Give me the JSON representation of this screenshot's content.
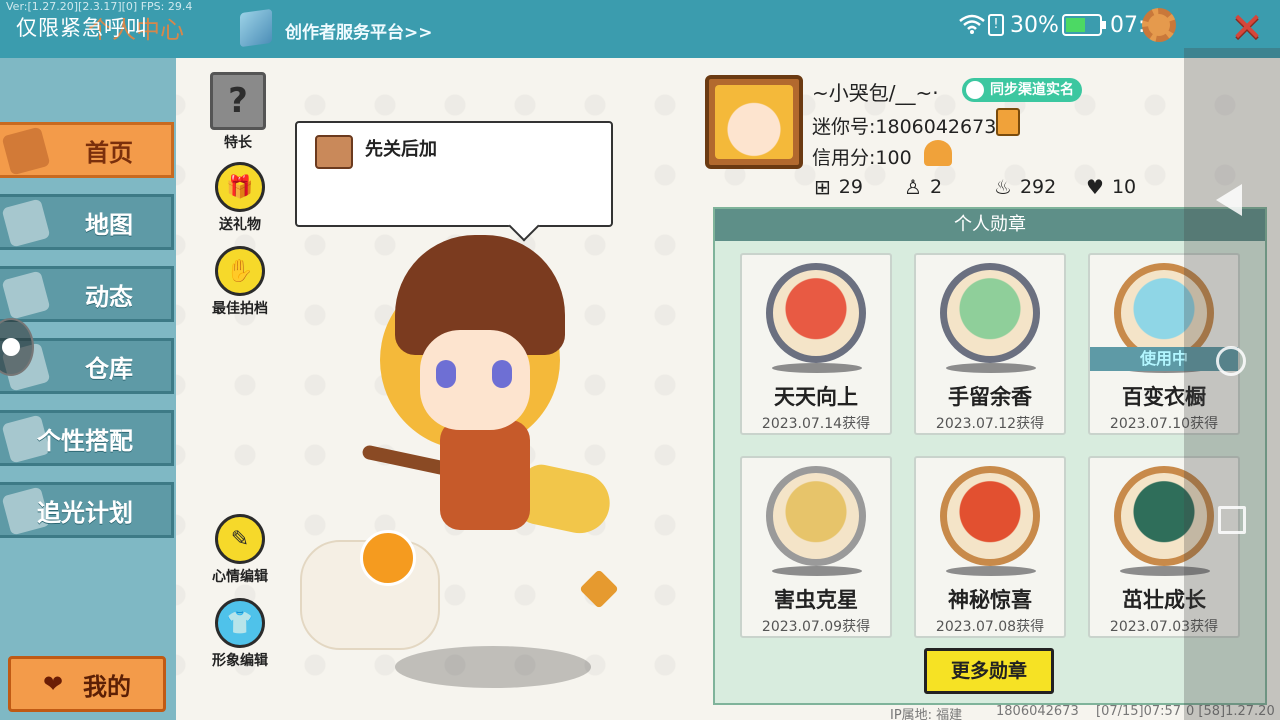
{
  "debug_line": "Ver:[1.27.20][2.3.17][0] FPS: 29.4",
  "header": {
    "emergency_label": "仅限紧急呼叫",
    "page_title_partial": "个人中心",
    "creator_link": "创作者服务平台>>"
  },
  "status_bar": {
    "battery_pct": "30%",
    "time": "07:57",
    "close_glyph": "✕"
  },
  "sidebar": {
    "items": [
      {
        "label": "首页",
        "active": true
      },
      {
        "label": "地图"
      },
      {
        "label": "动态"
      },
      {
        "label": "仓库"
      },
      {
        "label": "个性搭配"
      },
      {
        "label": "追光计划"
      }
    ],
    "me_button": "我的"
  },
  "tools": {
    "specialty": "特长",
    "send_gift": "送礼物",
    "best_photo": "最佳拍档",
    "mood_edit": "心情编辑",
    "image_edit": "形象编辑"
  },
  "bubble": {
    "text": "先关后加"
  },
  "profile": {
    "nickname": "~小哭包/__~·",
    "realname_badge": "同步渠道实名",
    "mini_id": "迷你号:1806042673",
    "credit": "信用分:100",
    "stats": {
      "fans": "29",
      "follow": "2",
      "popularity": "292",
      "likes": "10"
    }
  },
  "medal_panel": {
    "title": "个人勋章",
    "medals": [
      {
        "name": "天天向上",
        "date": "2023.07.14获得",
        "ring": "#6b7080",
        "fill": "#e85a43"
      },
      {
        "name": "手留余香",
        "date": "2023.07.12获得",
        "ring": "#6b7080",
        "fill": "#8fcf9a"
      },
      {
        "name": "百变衣橱",
        "date": "2023.07.10获得",
        "ring": "#c88a4a",
        "fill": "#8fd6e6",
        "in_use": "使用中"
      },
      {
        "name": "害虫克星",
        "date": "2023.07.09获得",
        "ring": "#9a9a9a",
        "fill": "#e7c46a"
      },
      {
        "name": "神秘惊喜",
        "date": "2023.07.08获得",
        "ring": "#c88a4a",
        "fill": "#e25030"
      },
      {
        "name": "茁壮成长",
        "date": "2023.07.03获得",
        "ring": "#c88a4a",
        "fill": "#2f6e5a"
      }
    ],
    "more_button": "更多勋章"
  },
  "footer": {
    "ip": "IP属地: 福建",
    "uid": "1806042673",
    "timestamp": "[07/15]07:57",
    "version": "0  [58]1.27.20"
  }
}
